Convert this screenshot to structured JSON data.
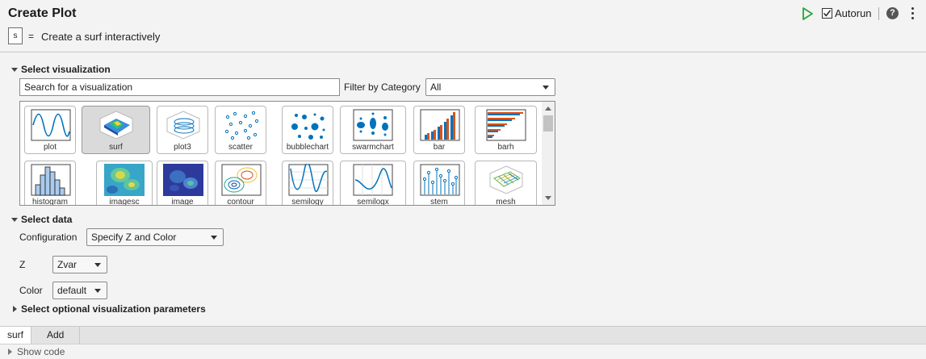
{
  "header": {
    "title": "Create Plot",
    "symbol": "s",
    "equals": "=",
    "summary": "Create a surf interactively",
    "autorun_label": "Autorun",
    "autorun_checked": true,
    "help_glyph": "?"
  },
  "visualization": {
    "section_label": "Select visualization",
    "search_value": "Search for a visualization",
    "filter_label": "Filter by Category",
    "filter_value": "All",
    "selected": "surf",
    "tiles": [
      {
        "label": "plot",
        "icon": "plot-icon"
      },
      {
        "label": "surf",
        "icon": "surf-icon"
      },
      {
        "label": "plot3",
        "icon": "plot3-icon"
      },
      {
        "label": "scatter",
        "icon": "scatter-icon"
      },
      {
        "label": "bubblechart",
        "icon": "bubblechart-icon"
      },
      {
        "label": "swarmchart",
        "icon": "swarmchart-icon"
      },
      {
        "label": "bar",
        "icon": "bar-icon"
      },
      {
        "label": "barh",
        "icon": "barh-icon"
      },
      {
        "label": "histogram",
        "icon": "histogram-icon"
      },
      {
        "label": "imagesc",
        "icon": "imagesc-icon"
      },
      {
        "label": "image",
        "icon": "image-icon"
      },
      {
        "label": "contour",
        "icon": "contour-icon"
      },
      {
        "label": "semilogy",
        "icon": "semilogy-icon"
      },
      {
        "label": "semilogx",
        "icon": "semilogx-icon"
      },
      {
        "label": "stem",
        "icon": "stem-icon"
      },
      {
        "label": "mesh",
        "icon": "mesh-icon"
      }
    ]
  },
  "data": {
    "section_label": "Select data",
    "configuration_label": "Configuration",
    "configuration_value": "Specify Z and Color",
    "z_label": "Z",
    "z_value": "Zvar",
    "color_label": "Color",
    "color_value": "default"
  },
  "optional": {
    "section_label": "Select optional visualization parameters"
  },
  "tabs": [
    {
      "label": "surf",
      "active": true
    },
    {
      "label": "Add",
      "active": false
    }
  ],
  "footer": {
    "show_code_label": "Show code"
  },
  "colors": {
    "run_green": "#27a637",
    "line_blue": "#0072bd",
    "bar_orange": "#d95319"
  }
}
